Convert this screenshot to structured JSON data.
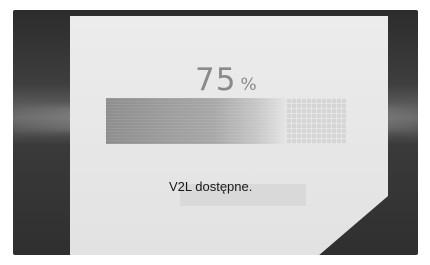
{
  "charge": {
    "value": "75",
    "unit": "%",
    "fraction": 0.75
  },
  "status": {
    "message": "V2L dostępne."
  }
}
